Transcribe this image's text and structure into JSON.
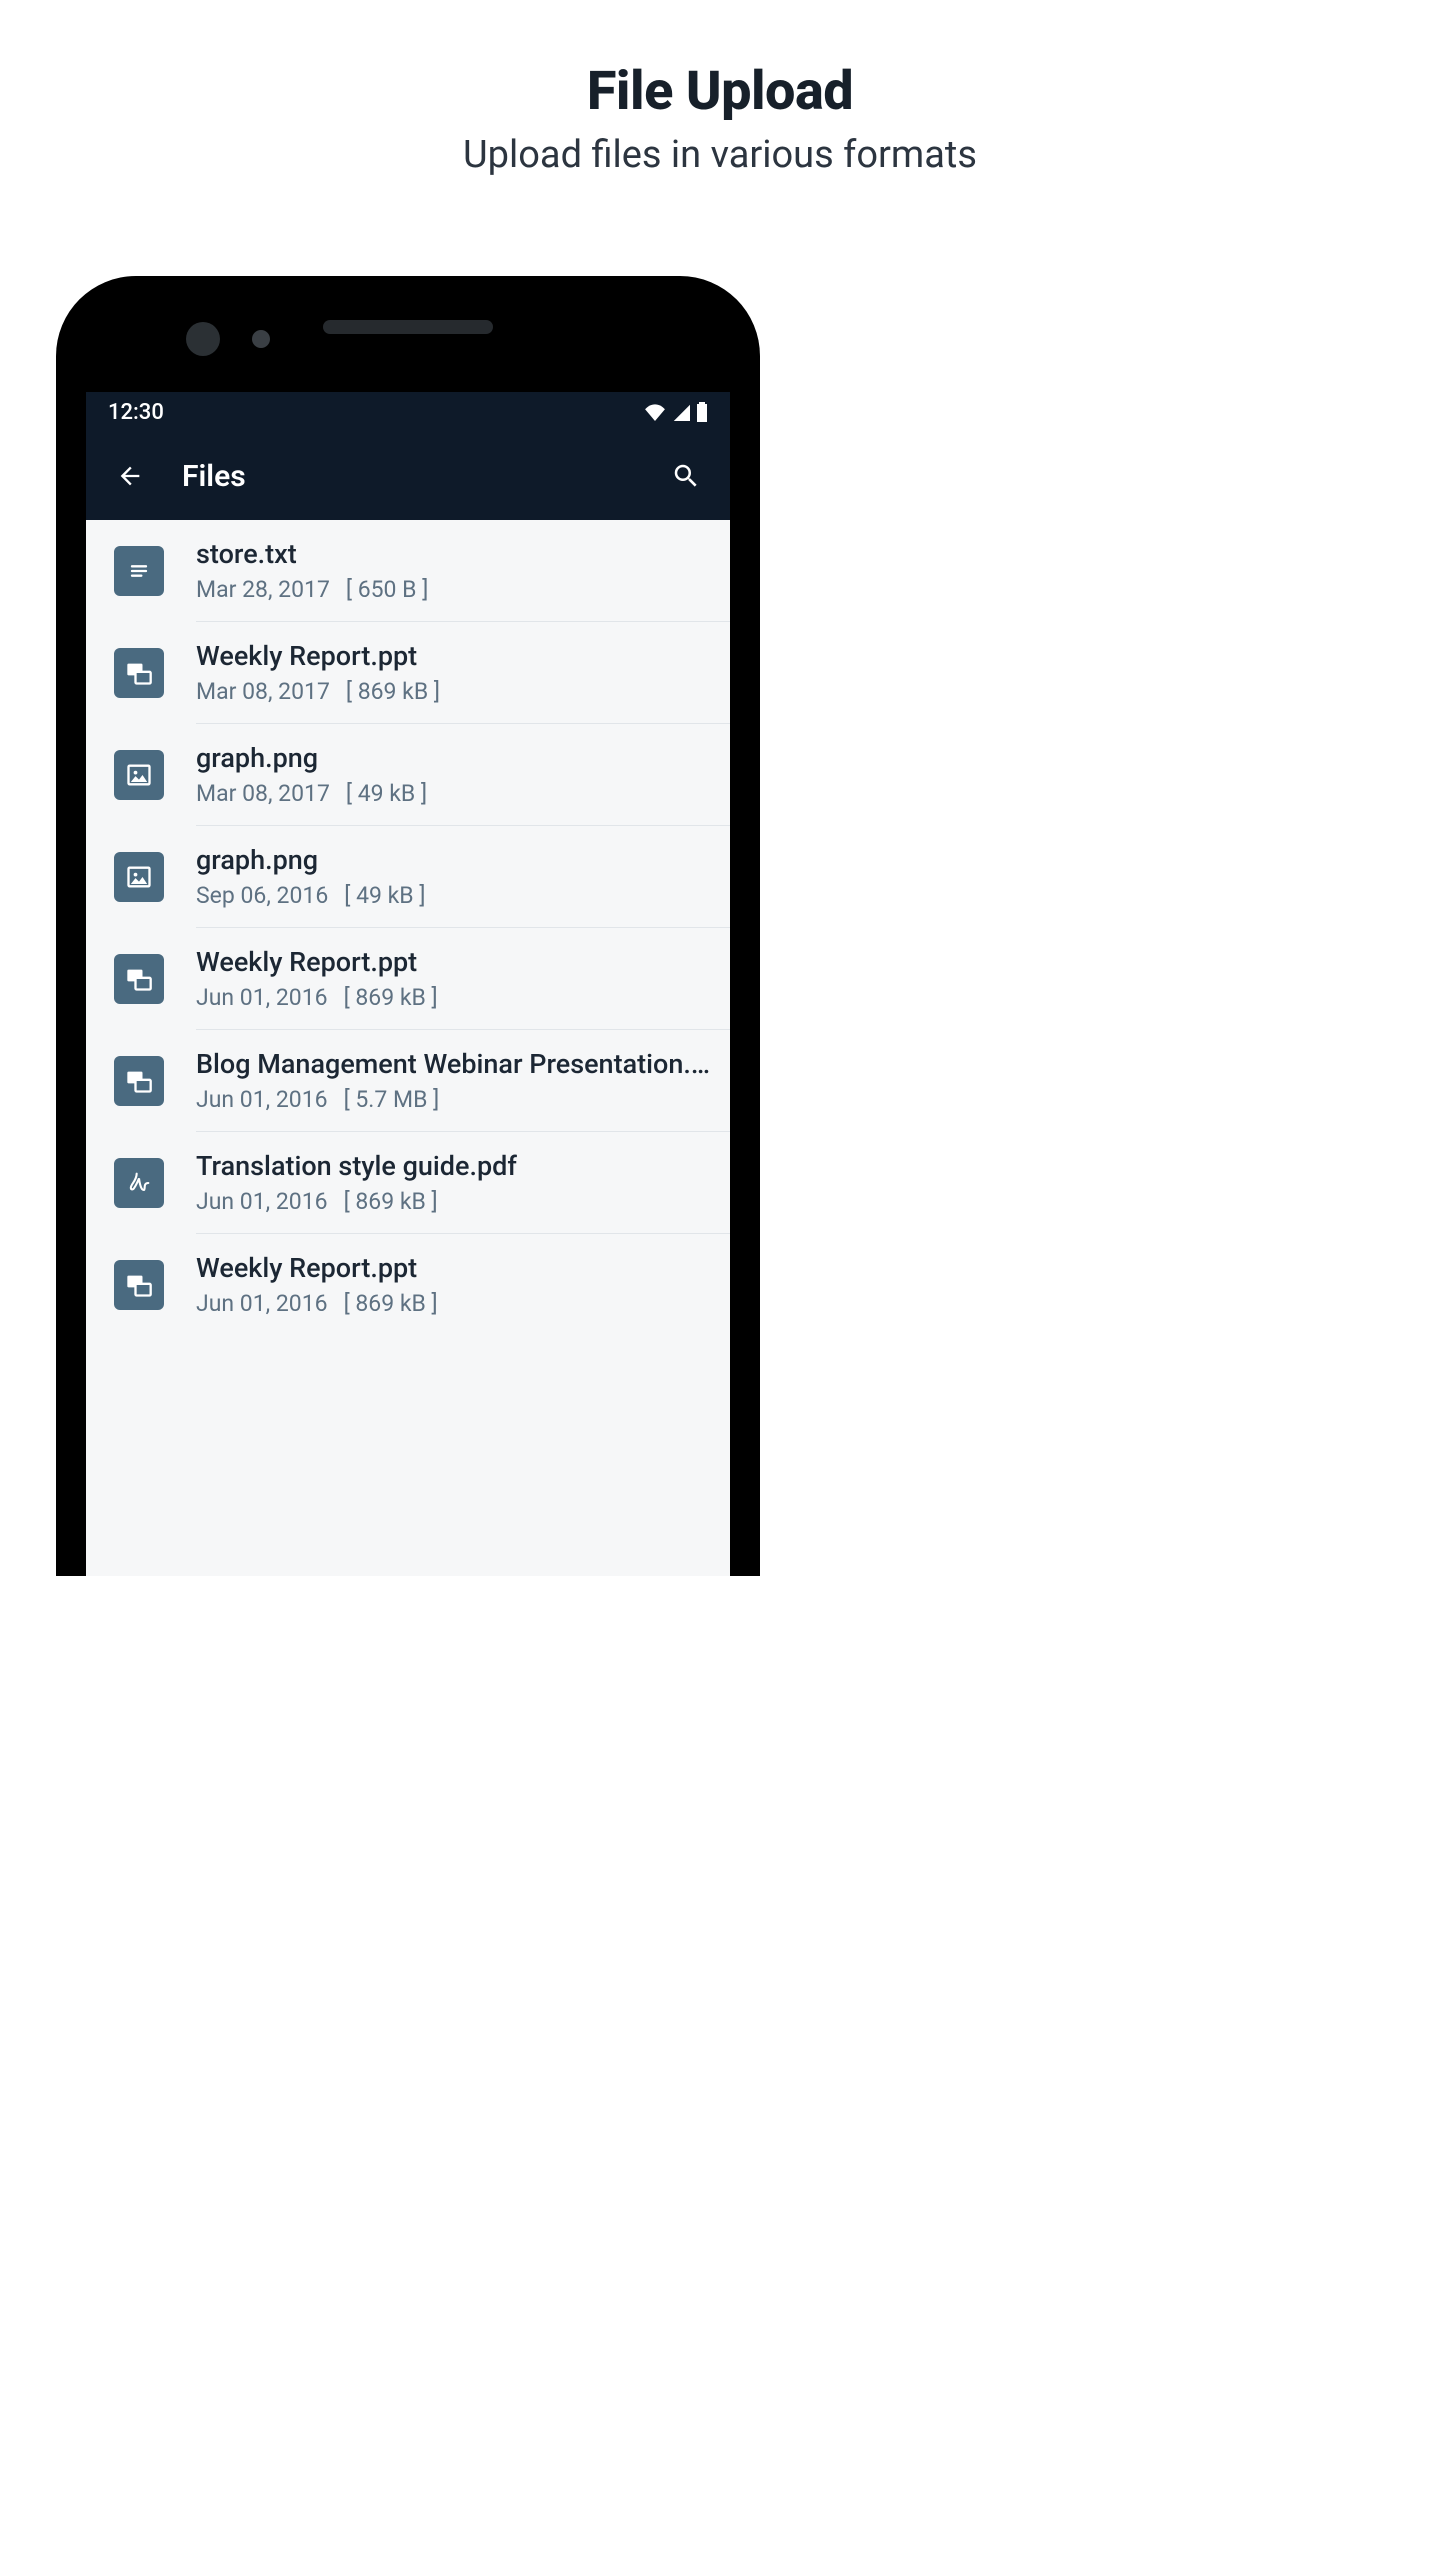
{
  "hero": {
    "title": "File Upload",
    "subtitle": "Upload files in various formats"
  },
  "status": {
    "time": "12:30"
  },
  "appbar": {
    "title": "Files"
  },
  "files": [
    {
      "icon": "doc",
      "name": "store.txt",
      "date": "Mar 28, 2017",
      "size": "[ 650 B ]"
    },
    {
      "icon": "ppt",
      "name": "Weekly Report.ppt",
      "date": "Mar 08, 2017",
      "size": "[ 869 kB ]"
    },
    {
      "icon": "img",
      "name": "graph.png",
      "date": "Mar 08, 2017",
      "size": "[ 49 kB ]"
    },
    {
      "icon": "img",
      "name": "graph.png",
      "date": "Sep 06, 2016",
      "size": "[ 49 kB ]"
    },
    {
      "icon": "ppt",
      "name": "Weekly Report.ppt",
      "date": "Jun 01, 2016",
      "size": "[ 869 kB ]"
    },
    {
      "icon": "ppt",
      "name": "Blog Management Webinar Presentation.…",
      "date": "Jun 01, 2016",
      "size": "[ 5.7 MB ]"
    },
    {
      "icon": "pdf",
      "name": "Translation style guide.pdf",
      "date": "Jun 01, 2016",
      "size": "[ 869 kB ]"
    },
    {
      "icon": "ppt",
      "name": "Weekly Report.ppt",
      "date": "Jun 01, 2016",
      "size": "[ 869 kB ]"
    }
  ]
}
